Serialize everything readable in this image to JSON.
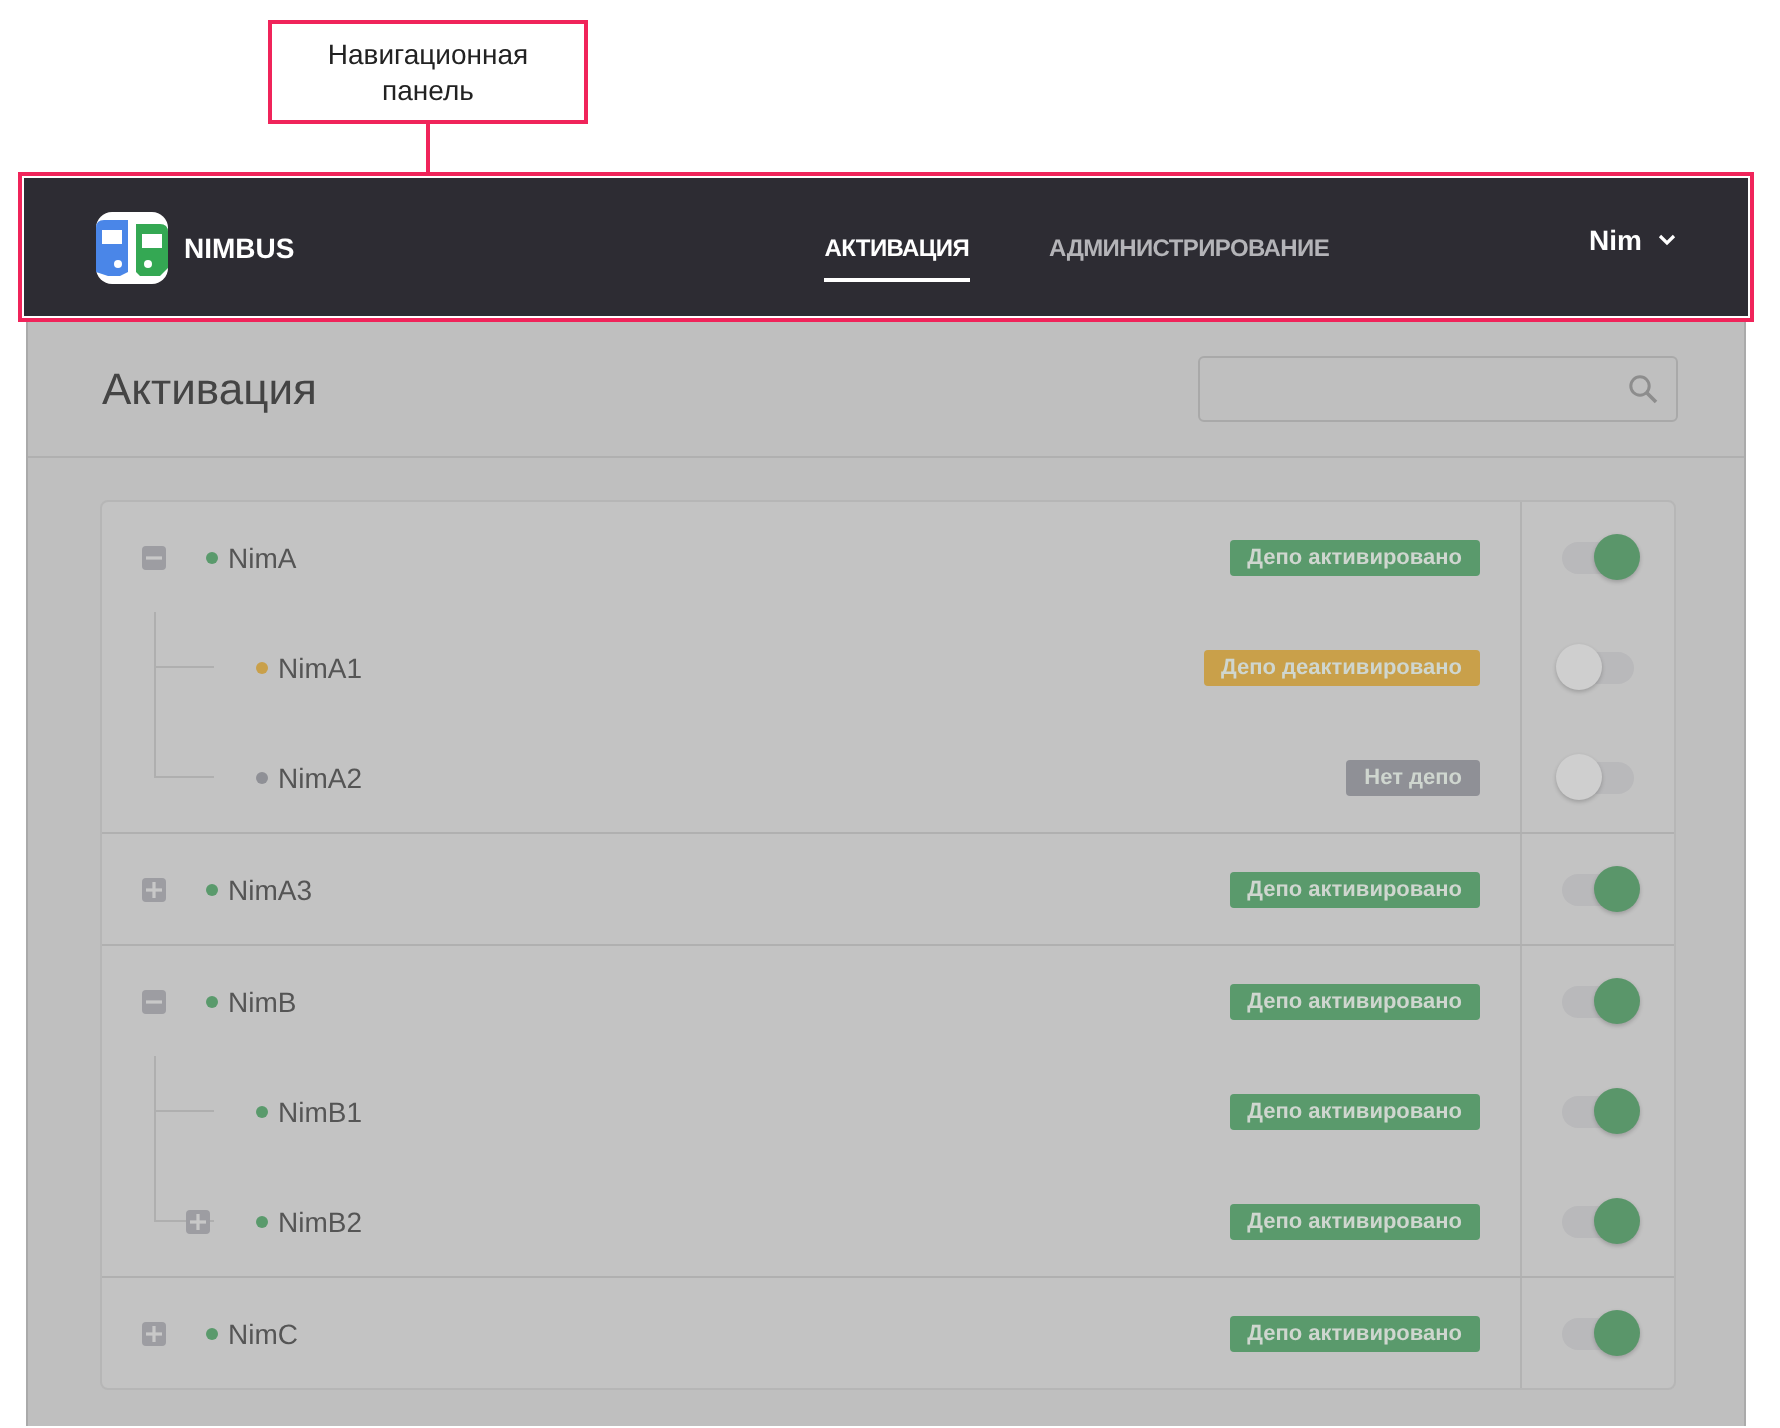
{
  "callout": {
    "text": "Навигационная панель"
  },
  "navbar": {
    "brand": "NIMBUS",
    "tabs": [
      {
        "label": "АКТИВАЦИЯ",
        "selected": true
      },
      {
        "label": "АДМИНИСТРИРОВАНИЕ",
        "selected": false
      }
    ],
    "user": "Nim"
  },
  "page": {
    "title": "Активация"
  },
  "tree": [
    {
      "name": "NimA",
      "color": "#5a9a6c",
      "status": {
        "label": "Депо активировано",
        "kind": "active"
      },
      "on": true,
      "expanded": true,
      "children": [
        {
          "name": "NimA1",
          "color": "#c9a04a",
          "status": {
            "label": "Депо деактивировано",
            "kind": "inactive"
          },
          "on": false
        },
        {
          "name": "NimA2",
          "color": "#8f9096",
          "status": {
            "label": "Нет депо",
            "kind": "none"
          },
          "on": false
        }
      ]
    },
    {
      "name": "NimA3",
      "color": "#5a9a6c",
      "status": {
        "label": "Депо активировано",
        "kind": "active"
      },
      "on": true,
      "expanded": false
    },
    {
      "name": "NimB",
      "color": "#5a9a6c",
      "status": {
        "label": "Депо активировано",
        "kind": "active"
      },
      "on": true,
      "expanded": true,
      "children": [
        {
          "name": "NimB1",
          "color": "#5a9a6c",
          "status": {
            "label": "Депо активировано",
            "kind": "active"
          },
          "on": true
        },
        {
          "name": "NimB2",
          "color": "#5a9a6c",
          "status": {
            "label": "Депо активировано",
            "kind": "active"
          },
          "on": true,
          "expanded": false
        }
      ]
    },
    {
      "name": "NimC",
      "color": "#5a9a6c",
      "status": {
        "label": "Депо активировано",
        "kind": "active"
      },
      "on": true,
      "expanded": false
    }
  ]
}
